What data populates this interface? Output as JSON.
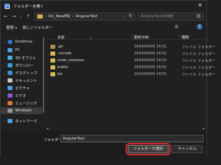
{
  "window": {
    "title": "フォルダーを開く",
    "close_glyph": "✕"
  },
  "nav": {
    "back": "←",
    "forward": "→",
    "history": "⌄",
    "up": "↑",
    "path": [
      "Src_NewPRJ",
      "AngularTest"
    ],
    "search_placeholder": "AngularTestの検索"
  },
  "toolbar": {
    "organize": "整理",
    "new_folder": "新しいフォルダー",
    "view_icon": "☰",
    "help": "?"
  },
  "sidebar": {
    "items": [
      {
        "label": "OneDrive -",
        "icon": "cloud-icon",
        "color": "#2b7cd3"
      },
      {
        "label": "PC",
        "icon": "pc-icon",
        "color": "#4aa3e8"
      },
      {
        "label": "3D オブジェ",
        "icon": "cube-icon",
        "color": "#46b0e0"
      },
      {
        "label": "ダウンロー",
        "icon": "download-icon",
        "color": "#3aa0e0"
      },
      {
        "label": "デスクトップ",
        "icon": "desktop-icon",
        "color": "#3a8fd8"
      },
      {
        "label": "ドキュメント",
        "icon": "document-icon",
        "color": "#c9c9c9"
      },
      {
        "label": "ピクチャ",
        "icon": "picture-icon",
        "color": "#4aa3e8"
      },
      {
        "label": "ビデオ",
        "icon": "video-icon",
        "color": "#8a5ad8"
      },
      {
        "label": "ミュージック",
        "icon": "music-icon",
        "color": "#e07a3a"
      },
      {
        "label": "Windows",
        "icon": "drive-icon",
        "color": "#9a9a9a"
      },
      {
        "label": "ネットワーク",
        "icon": "network-icon",
        "color": "#4aa3e8"
      }
    ]
  },
  "columns": {
    "name": "名前",
    "date": "更新日時",
    "type": "種類"
  },
  "files": [
    {
      "name": ".git",
      "date": "2024/09/05 14:51",
      "type": "ファイル フォルダー"
    },
    {
      "name": ".vscode",
      "date": "2024/09/05 14:51",
      "type": "ファイル フォルダー"
    },
    {
      "name": "node_modules",
      "date": "2024/09/05 14:51",
      "type": "ファイル フォルダー"
    },
    {
      "name": "public",
      "date": "2024/09/05 14:51",
      "type": "ファイル フォルダー"
    },
    {
      "name": "src",
      "date": "2024/09/05 14:51",
      "type": "ファイル フォルダー"
    }
  ],
  "footer": {
    "folder_label": "フォルダー:",
    "folder_value": "AngularTest",
    "select_button": "フォルダーの選択",
    "cancel_button": "キャンセル"
  },
  "colors": {
    "accent_highlight": "#e1262c",
    "folder": "#d9b94f"
  }
}
